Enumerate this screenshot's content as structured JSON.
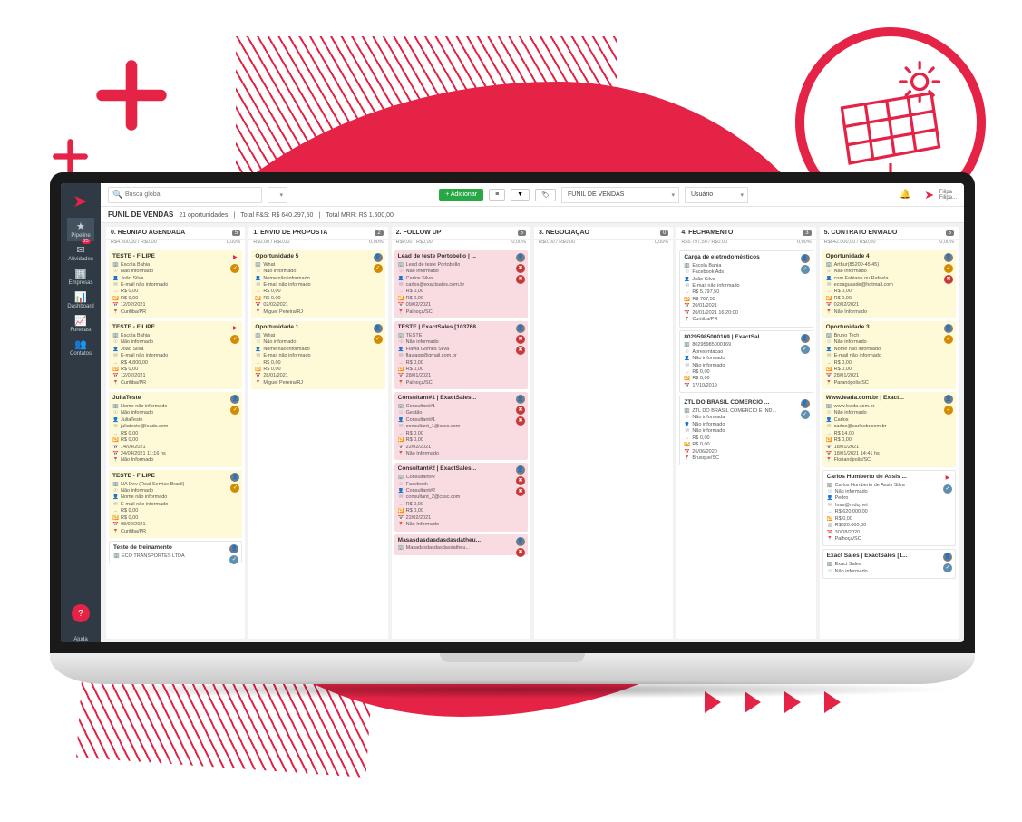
{
  "sidebar": {
    "items": [
      {
        "icon": "★",
        "label": "Pipeline",
        "active": true
      },
      {
        "icon": "✉",
        "label": "Atividades",
        "badge": "25"
      },
      {
        "icon": "🏢",
        "label": "Empresas"
      },
      {
        "icon": "📊",
        "label": "Dashboard"
      },
      {
        "icon": "📈",
        "label": "Forecast"
      },
      {
        "icon": "👥",
        "label": "Contatos"
      }
    ],
    "help_label": "Ajuda"
  },
  "header": {
    "search_placeholder": "Busca global",
    "add_label": "+ Adicionar",
    "funnel_select": "FUNIL DE VENDAS",
    "user_select": "Usuário",
    "user_name": "Filipa",
    "user_sub": "Filipa..."
  },
  "summary": {
    "title": "FUNIL DE VENDAS",
    "opp_text": "21 oportunidades",
    "total_fs": "Total F&S: R$ 640.297,50",
    "total_mrr": "Total MRR: R$ 1.500,00"
  },
  "columns": [
    {
      "name": "0. REUNIAO AGENDADA",
      "count": 5,
      "sub": "R$4.800,00 / R$0,00",
      "pct": "0,00%",
      "cards": [
        {
          "title": "TESTE - FILIPE",
          "color": "yellow",
          "icons": [
            "flag",
            "warn"
          ],
          "lines": [
            "🏢 Escola Bahia",
            "☉ Não informado",
            "👤 João Silva",
            "✉ E-mail não informado",
            "→ R$ 0,00",
            "🔁 R$ 0,00",
            "📅 12/02/2021",
            "📍 Curitiba/PR"
          ]
        },
        {
          "title": "TESTE - FILIPE",
          "color": "yellow",
          "icons": [
            "flag",
            "warn"
          ],
          "lines": [
            "🏢 Escola Bahia",
            "☉ Não informado",
            "👤 João Silva",
            "✉ E-mail não informado",
            "→ R$ 4.800,00",
            "🔁 R$ 0,00",
            "📅 12/02/2021",
            "📍 Curitiba/PR"
          ]
        },
        {
          "title": "JuliaTeste",
          "color": "yellow",
          "icons": [
            "av",
            "warn"
          ],
          "lines": [
            "🏢 Nome não informado",
            "☉ Não informado",
            "👤 JuliaTeste",
            "✉ juliateste@leads.com",
            "→ R$ 0,00",
            "🔁 R$ 0,00",
            "📅 14/04/2021",
            "📅 24/04/2021 11:16 hs",
            "📍 Não Informado"
          ]
        },
        {
          "title": "TESTE - FILIPE",
          "color": "yellow",
          "icons": [
            "av",
            "warn"
          ],
          "lines": [
            "🏢 NA Dev (Real Service Brasil)",
            "☉ Não informado",
            "👤 Nome não informado",
            "✉ E-mail não informado",
            "→ R$ 0,00",
            "🔁 R$ 0,00",
            "📅 08/02/2021",
            "📍 Curitiba/PR"
          ]
        },
        {
          "title": "Teste de treinamento",
          "color": "white",
          "icons": [
            "av",
            "ok"
          ],
          "lines": [
            "🏢 ECO TRANSPORTES LTDA"
          ]
        }
      ]
    },
    {
      "name": "1. ENVIO DE PROPOSTA",
      "count": 2,
      "sub": "R$0,00 / R$0,00",
      "pct": "0,00%",
      "cards": [
        {
          "title": "Oportunidade 5",
          "color": "yellow",
          "icons": [
            "av",
            "warn"
          ],
          "lines": [
            "🏢 What",
            "☉ Não informado",
            "👤 Nome não informado",
            "✉ E-mail não informado",
            "→ R$ 0,00",
            "🔁 R$ 0,00",
            "📅 02/02/2021",
            "📍 Miguel Pereira/RJ"
          ]
        },
        {
          "title": "Oportunidade 1",
          "color": "yellow",
          "icons": [
            "av",
            "warn"
          ],
          "lines": [
            "🏢 What",
            "☉ Não informado",
            "👤 Nome não informado",
            "✉ E-mail não informado",
            "→ R$ 0,00",
            "🔁 R$ 0,00",
            "📅 28/01/2021",
            "📍 Miguel Pereira/RJ"
          ]
        }
      ]
    },
    {
      "name": "2. FOLLOW UP",
      "count": 5,
      "sub": "R$0,00 / R$0,00",
      "pct": "0,00%",
      "cards": [
        {
          "title": "Lead de teste Portobello | ...",
          "color": "pink",
          "icons": [
            "av",
            "bad",
            "bad"
          ],
          "lines": [
            "🏢 Lead de teste Portobello",
            "☉ Não informado",
            "👤 Carlos Silva",
            "✉ carlos@exactsales.com.br",
            "→ R$ 0,00",
            "🔁 R$ 0,00",
            "📅 09/02/2021",
            "📍 Palhoça/SC"
          ]
        },
        {
          "title": "TESTE | ExactSales [103768...",
          "color": "pink",
          "icons": [
            "av",
            "bad",
            "bad"
          ],
          "lines": [
            "🏢 TESTE",
            "☉ Não informado",
            "👤 Flávia Gomes Silva",
            "✉ flaviagp@gmail.com.br",
            "→ R$ 0,00",
            "🔁 R$ 0,00",
            "📅 28/01/2021",
            "📍 Palhoça/SC"
          ]
        },
        {
          "title": "Consultant#1 | ExactSales...",
          "color": "pink",
          "icons": [
            "av",
            "bad",
            "bad"
          ],
          "lines": [
            "🏢 Consultant#1",
            "☉ Gestão",
            "👤 Consultant#1",
            "✉ consultant_1@cssc.com",
            "→ R$ 0,00",
            "🔁 R$ 0,00",
            "📅 22/02/2021",
            "📍 Não Informado"
          ]
        },
        {
          "title": "Consultant#2 | ExactSales...",
          "color": "pink",
          "icons": [
            "av",
            "bad",
            "bad"
          ],
          "lines": [
            "🏢 Consultant#2",
            "☉ Facebook",
            "👤 Consultant#2",
            "✉ consultant_2@cssc.com",
            "→ R$ 0,00",
            "🔁 R$ 0,00",
            "📅 22/02/2021",
            "📍 Não Informado"
          ]
        },
        {
          "title": "Masasdasdasdasdasdatheu...",
          "color": "pink",
          "icons": [
            "av",
            "bad"
          ],
          "lines": [
            "🏢 Masadasdasdasdasdatheu..."
          ]
        }
      ]
    },
    {
      "name": "3. NEGOCIAÇÃO",
      "count": 0,
      "sub": "R$0,00 / R$0,00",
      "pct": "0,00%",
      "cards": []
    },
    {
      "name": "4. FECHAMENTO",
      "count": 3,
      "sub": "R$5.797,50 / R$0,00",
      "pct": "0,00%",
      "cards": [
        {
          "title": "Carga de eletrodomésticos",
          "color": "white",
          "icons": [
            "av",
            "ok"
          ],
          "lines": [
            "🏢 Escola Bahia",
            "☉ Facebook Ads",
            "👤 João Silva",
            "✉ E-mail não informado",
            "→ R$ 5.797,50",
            "🔁 R$ 767,50",
            "📅 20/01/2021",
            "📅 20/01/2021 16:20:00",
            "📍 Curitiba/PR"
          ]
        },
        {
          "title": "80295985000169 | ExactSal...",
          "color": "white",
          "icons": [
            "av",
            "ok"
          ],
          "lines": [
            "🏢 80295985000169",
            "☉ Apresentacao",
            "👤 Não informado",
            "✉ Não informado",
            "→ R$ 0,00",
            "🔁 R$ 0,00",
            "📅 17/10/2019"
          ]
        },
        {
          "title": "ZTL DO BRASIL COMERCIO ...",
          "color": "white",
          "icons": [
            "av",
            "ok"
          ],
          "lines": [
            "🏢 ZTL DO BRASIL COMERCIO E IND...",
            "☉ Não informada",
            "👤 Não informado",
            "✉ Não informado",
            "→ R$ 0,00",
            "🔁 R$ 0,00",
            "📅 26/06/2020",
            "📍 Brusque/SC"
          ]
        }
      ]
    },
    {
      "name": "5. CONTRATO ENVIADO",
      "count": 5,
      "sub": "R$642.000,00 / R$0,00",
      "pct": "0,00%",
      "cards": [
        {
          "title": "Oportunidade 4",
          "color": "yellow",
          "icons": [
            "av",
            "warn",
            "bad"
          ],
          "lines": [
            "🏢 Arthur(85200-45:45)",
            "☉ Não informado",
            "👤 com Fabiano ou Rafaela",
            "✉ ecoaguasde@hotmail.com",
            "→ R$ 0,00",
            "🔁 R$ 0,00",
            "📅 02/02/2021",
            "📍 Não Informado"
          ]
        },
        {
          "title": "Oportunidade 3",
          "color": "yellow",
          "icons": [
            "av",
            "warn"
          ],
          "lines": [
            "🏢 Bruno Tech",
            "☉ Não informado",
            "👤 Nome não informado",
            "✉ E-mail não informado",
            "→ R$ 0,00",
            "🔁 R$ 0,00",
            "📅 28/01/2021",
            "📍 Paranópolis/SC"
          ]
        },
        {
          "title": "Www.leada.com.br | Exact...",
          "color": "yellow",
          "icons": [
            "av",
            "warn"
          ],
          "lines": [
            "🏢 www.leada.com.br",
            "☉ Não informado",
            "👤 Carlos",
            "✉ carlos@carlosbr.com.br",
            "→ R$ 14,00",
            "🔁 R$ 0,00",
            "📅 18/01/2021",
            "📅 18/01/2021 14:41 hs",
            "📍 Florianópolis/SC"
          ]
        },
        {
          "title": "Carlos Humberto de Assis ...",
          "color": "white",
          "icons": [
            "flag",
            "ok"
          ],
          "lines": [
            "🏢 Carlos Humberto de Assis Silva",
            "☉ Não informado",
            "👤 Pedro",
            "✉ hras@mdq.net",
            "→ R$ 620.000,00",
            "🔁 R$ 0,00",
            "🗎 R$820.000,00",
            "📅 30/08/2020",
            "📍 Palhoça/SC"
          ]
        },
        {
          "title": "Exact Sales | ExactSales [1...",
          "color": "white",
          "icons": [
            "av",
            "ok"
          ],
          "lines": [
            "🏢 Exact Sales",
            "☉ Não informado"
          ]
        }
      ]
    }
  ]
}
